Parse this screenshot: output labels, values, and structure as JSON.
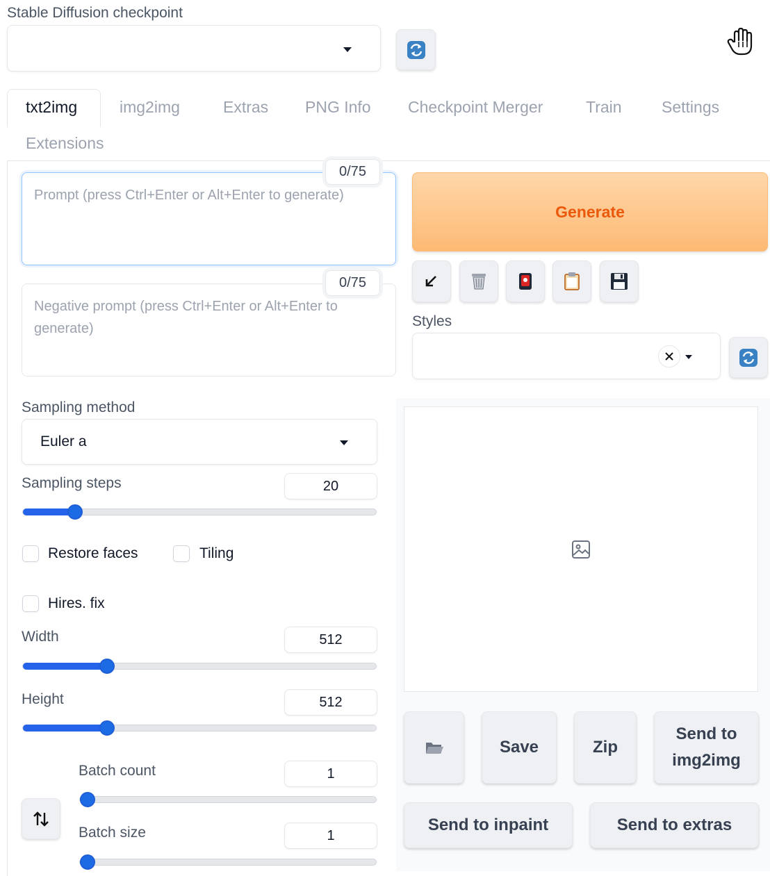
{
  "checkpoint": {
    "label": "Stable Diffusion checkpoint",
    "value": ""
  },
  "tabs": [
    {
      "label": "txt2img",
      "active": true
    },
    {
      "label": "img2img"
    },
    {
      "label": "Extras"
    },
    {
      "label": "PNG Info"
    },
    {
      "label": "Checkpoint Merger"
    },
    {
      "label": "Train"
    },
    {
      "label": "Settings"
    },
    {
      "label": "Extensions"
    }
  ],
  "prompt": {
    "placeholder": "Prompt (press Ctrl+Enter or Alt+Enter to generate)",
    "counter": "0/75"
  },
  "negative_prompt": {
    "placeholder": "Negative prompt (press Ctrl+Enter or Alt+Enter to generate)",
    "counter": "0/75"
  },
  "generate": {
    "label": "Generate"
  },
  "styles": {
    "label": "Styles",
    "value": ""
  },
  "sampling_method": {
    "label": "Sampling method",
    "value": "Euler a"
  },
  "sampling_steps": {
    "label": "Sampling steps",
    "value": "20",
    "fraction": 0.147
  },
  "restore_faces": {
    "label": "Restore faces",
    "checked": false
  },
  "tiling": {
    "label": "Tiling",
    "checked": false
  },
  "hires_fix": {
    "label": "Hires. fix",
    "checked": false
  },
  "width": {
    "label": "Width",
    "value": "512",
    "fraction": 0.238
  },
  "height": {
    "label": "Height",
    "value": "512",
    "fraction": 0.238
  },
  "batch_count": {
    "label": "Batch count",
    "value": "1",
    "fraction": 0.0
  },
  "batch_size": {
    "label": "Batch size",
    "value": "1",
    "fraction": 0.0
  },
  "output_actions": {
    "save": "Save",
    "zip": "Zip",
    "send_img2img_line1": "Send to",
    "send_img2img_line2": "img2img",
    "send_inpaint": "Send to inpaint",
    "send_extras": "Send to extras"
  },
  "colors": {
    "generate_text": "#ea580c",
    "slider": "#2563eb"
  }
}
